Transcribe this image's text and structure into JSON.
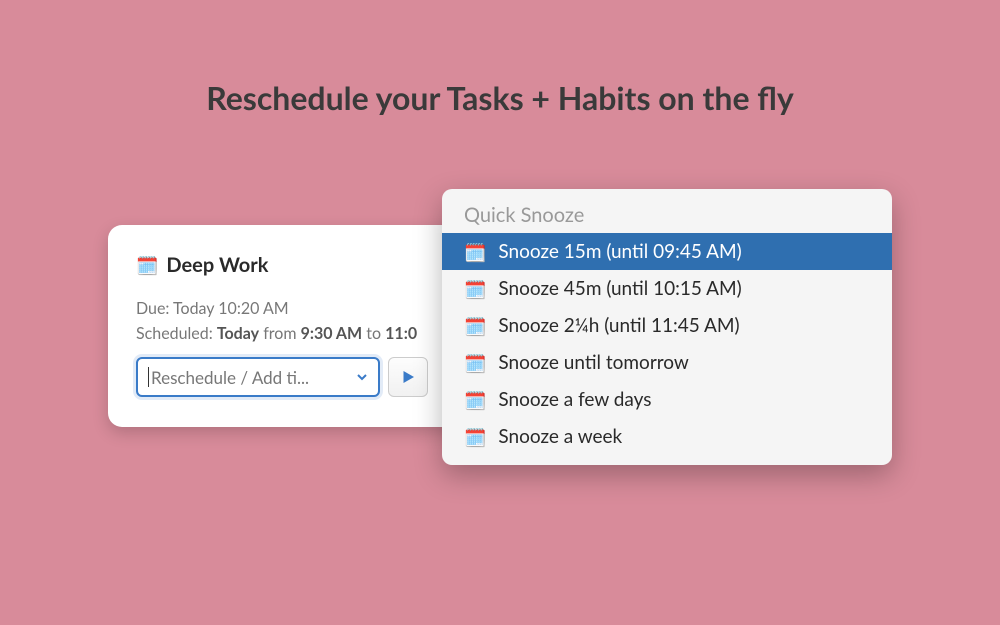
{
  "heading": "Reschedule your Tasks + Habits on the fly",
  "card": {
    "icon": "🗓️",
    "title": "Deep Work",
    "due_label": "Due: Today 10:20 AM",
    "scheduled_prefix": "Scheduled: ",
    "scheduled_day": "Today",
    "scheduled_mid": " from ",
    "scheduled_start": "9:30 AM",
    "scheduled_to": " to ",
    "scheduled_end": "11:0",
    "select_placeholder": "Reschedule / Add ti..."
  },
  "popup": {
    "header": "Quick Snooze",
    "items": [
      {
        "icon": "🗓️",
        "label": "Snooze 15m (until 09:45 AM)",
        "selected": true
      },
      {
        "icon": "🗓️",
        "label": "Snooze 45m (until 10:15 AM)",
        "selected": false
      },
      {
        "icon": "🗓️",
        "label": "Snooze 2¼h (until 11:45 AM)",
        "selected": false
      },
      {
        "icon": "🗓️",
        "label": "Snooze until tomorrow",
        "selected": false
      },
      {
        "icon": "🗓️",
        "label": "Snooze a few days",
        "selected": false
      },
      {
        "icon": "🗓️",
        "label": "Snooze a week",
        "selected": false
      }
    ]
  }
}
